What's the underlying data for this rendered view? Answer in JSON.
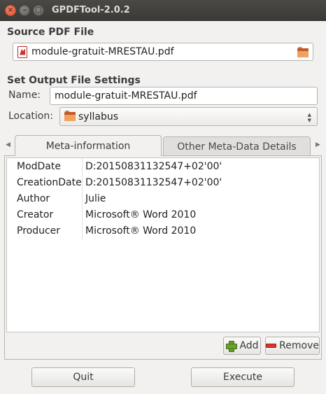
{
  "window": {
    "title": "GPDFTool-2.0.2",
    "close_glyph": "×",
    "minimize_glyph": "–",
    "maximize_glyph": "□"
  },
  "source": {
    "heading": "Source PDF File",
    "file_value": "module-gratuit-MRESTAU.pdf",
    "file_icon": "pdf-file-icon",
    "open_icon": "folder-open-icon"
  },
  "output": {
    "heading": "Set Output File Settings",
    "name_label": "Name:",
    "name_value": "module-gratuit-MRESTAU.pdf",
    "location_label": "Location:",
    "location_value": "syllabus",
    "location_icon": "folder-icon"
  },
  "tabs": {
    "left_arrow": "◀",
    "right_arrow": "▶",
    "items": [
      {
        "label": "Meta-information",
        "active": true
      },
      {
        "label": "Other Meta-Data Details",
        "active": false
      }
    ]
  },
  "meta": {
    "rows": [
      {
        "key": "ModDate",
        "value": "D:20150831132547+02'00'"
      },
      {
        "key": "CreationDate",
        "value": "D:20150831132547+02'00'"
      },
      {
        "key": "Author",
        "value": "Julie"
      },
      {
        "key": "Creator",
        "value": "Microsoft® Word 2010"
      },
      {
        "key": "Producer",
        "value": "Microsoft® Word 2010"
      }
    ]
  },
  "actions": {
    "add_label": "Add",
    "remove_label": "Remove",
    "quit_label": "Quit",
    "execute_label": "Execute"
  },
  "colors": {
    "titlebar": "#3b3a36",
    "close_button": "#e2532e",
    "window_bg": "#f2f1f0"
  }
}
